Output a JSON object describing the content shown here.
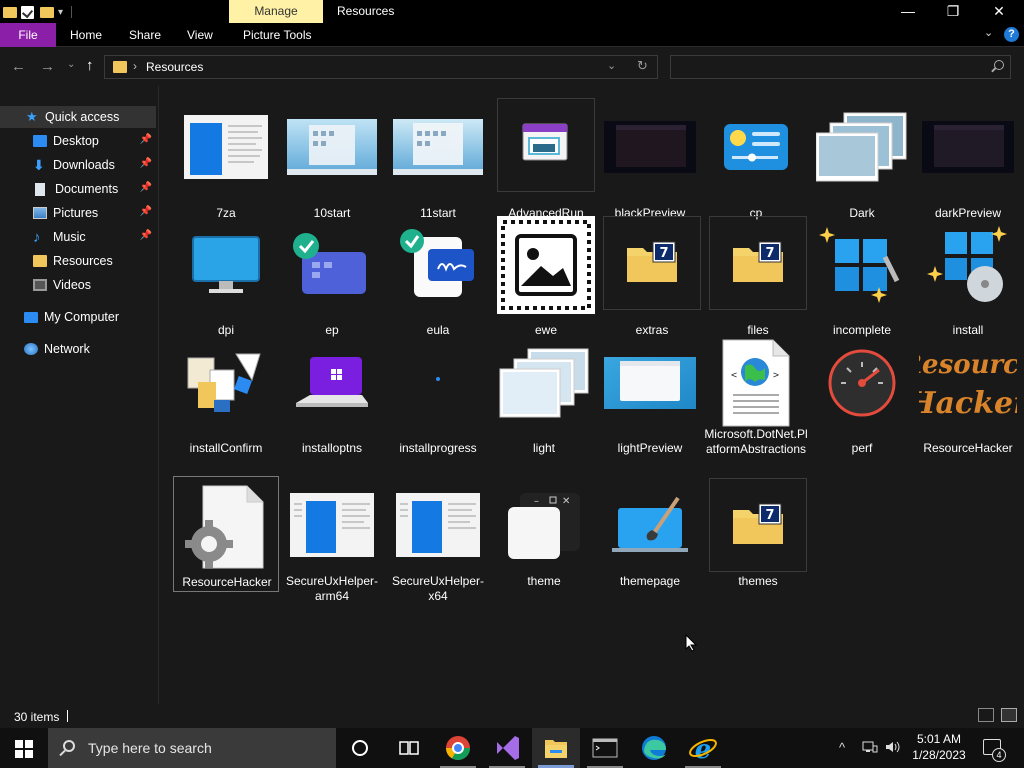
{
  "window": {
    "title": "Resources",
    "manage_tab": "Manage",
    "minimize": "—",
    "maximize": "❐",
    "close": "✕"
  },
  "ribbon": {
    "file": "File",
    "tabs": [
      "Home",
      "Share",
      "View",
      "Picture Tools"
    ]
  },
  "address": {
    "crumb": "Resources",
    "search_placeholder": ""
  },
  "navpane": {
    "quick_access": "Quick access",
    "items": [
      {
        "label": "Desktop",
        "pinned": true
      },
      {
        "label": "Downloads",
        "pinned": true
      },
      {
        "label": "Documents",
        "pinned": true
      },
      {
        "label": "Pictures",
        "pinned": true
      },
      {
        "label": "Music",
        "pinned": true
      },
      {
        "label": "Resources",
        "pinned": false
      },
      {
        "label": "Videos",
        "pinned": false
      }
    ],
    "my_computer": "My Computer",
    "network": "Network"
  },
  "files": [
    "7za",
    "10start",
    "11start",
    "AdvancedRun",
    "blackPreview",
    "cp",
    "Dark",
    "darkPreview",
    "dpi",
    "ep",
    "eula",
    "ewe",
    "extras",
    "files",
    "incomplete",
    "install",
    "installConfirm",
    "installoptns",
    "installprogress",
    "light",
    "lightPreview",
    "Microsoft.DotNet.PlatformAbstractions",
    "perf",
    "ResourceHacker",
    "ResourceHacker",
    "SecureUxHelper-arm64",
    "SecureUxHelper-x64",
    "theme",
    "themepage",
    "themes"
  ],
  "status": {
    "items": "30 items"
  },
  "taskbar": {
    "search_placeholder": "Type here to search",
    "time": "5:01 AM",
    "date": "1/28/2023",
    "notification_count": "4"
  },
  "colors": {
    "file_tab": "#8b1fa8",
    "manage_tab": "#fff2a6",
    "folder": "#f1c75b",
    "accent": "#1e7ad6"
  }
}
